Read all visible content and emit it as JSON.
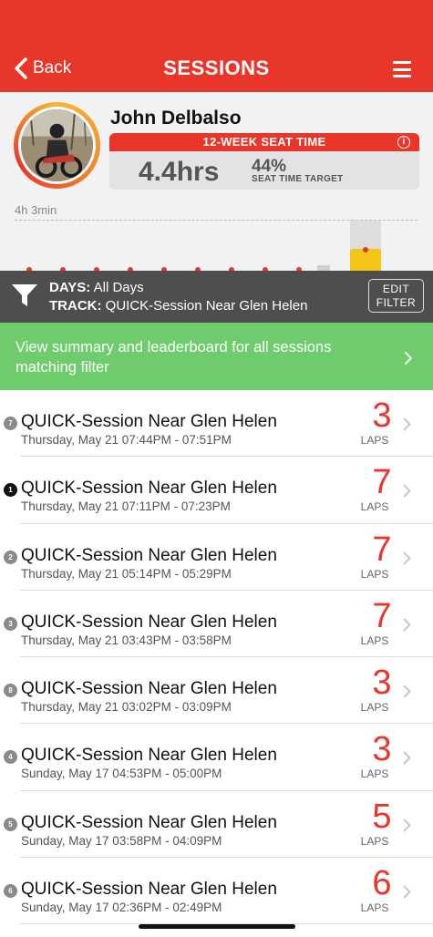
{
  "header": {
    "back_label": "Back",
    "title": "SESSIONS",
    "back_icon": "chevron-left-icon",
    "menu_icon": "hamburger-menu-icon"
  },
  "profile": {
    "name": "John Delbalso",
    "seat_time_title_pre": "12-WEEK ",
    "seat_time_title_strong": "SEAT TIME",
    "info": "i",
    "hours": "4.4hrs",
    "percent": "44%",
    "target_label": "SEAT TIME TARGET"
  },
  "chart": {
    "max_label": "4h 3min"
  },
  "filter": {
    "days_label": "DAYS:",
    "days_value": "All Days",
    "track_label": "TRACK:",
    "track_value": "QUICK-Session Near Glen Helen",
    "edit_line1": "EDIT",
    "edit_line2": "FILTER",
    "icon": "funnel-icon"
  },
  "summary": {
    "text": "View summary and leaderboard for all sessions matching filter"
  },
  "laps_label": "LAPS",
  "sessions": [
    {
      "rank": "7",
      "title": "QUICK-Session Near Glen Helen",
      "date": "Thursday, May 21 07:44PM - 07:51PM",
      "laps": "3"
    },
    {
      "rank": "1",
      "title": "QUICK-Session Near Glen Helen",
      "date": "Thursday, May 21 07:11PM - 07:23PM",
      "laps": "7"
    },
    {
      "rank": "2",
      "title": "QUICK-Session Near Glen Helen",
      "date": "Thursday, May 21 05:14PM - 05:29PM",
      "laps": "7"
    },
    {
      "rank": "3",
      "title": "QUICK-Session Near Glen Helen",
      "date": "Thursday, May 21 03:43PM - 03:58PM",
      "laps": "7"
    },
    {
      "rank": "8",
      "title": "QUICK-Session Near Glen Helen",
      "date": "Thursday, May 21 03:02PM - 03:09PM",
      "laps": "3"
    },
    {
      "rank": "4",
      "title": "QUICK-Session Near Glen Helen",
      "date": "Sunday, May 17 04:53PM - 05:00PM",
      "laps": "3"
    },
    {
      "rank": "5",
      "title": "QUICK-Session Near Glen Helen",
      "date": "Sunday, May 17 03:58PM - 04:09PM",
      "laps": "5"
    },
    {
      "rank": "6",
      "title": "QUICK-Session Near Glen Helen",
      "date": "Sunday, May 17 02:36PM - 02:49PM",
      "laps": "6"
    }
  ],
  "colors": {
    "brand_red": "#e8362a",
    "summary_green": "#6fcc6c",
    "filter_gray": "#4e4e4e",
    "bar_yellow": "#f5c518"
  }
}
